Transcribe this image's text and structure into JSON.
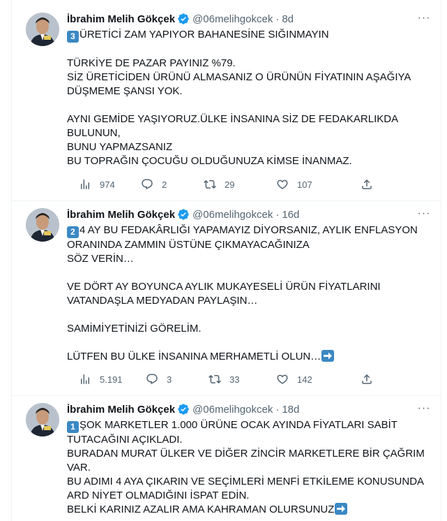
{
  "tweets": [
    {
      "author": "İbrahim Melih Gökçek",
      "handle": "@06melihgokcek",
      "time": "8d",
      "badge": "3",
      "first_line": "ÜRETİCİ ZAM YAPIYOR BAHANESİNE SIĞINMAYIN",
      "paragraphs": [
        "TÜRKİYE DE PAZAR PAYINIZ %79.\nSİZ ÜRETİCİDEN ÜRÜNÜ ALMASANIZ O ÜRÜNÜN FİYATININ AŞAĞIYA DÜŞMEME ŞANSI YOK.",
        "AYNI GEMİDE YAŞIYORUZ.ÜLKE İNSANINA SİZ DE FEDAKARLIKDA BULUNUN,\nBUNU YAPMAZSANIZ\nBU TOPRAĞIN ÇOCUĞU OLDUĞUNUZA KİMSE İNANMAZ."
      ],
      "views": "974",
      "replies": "2",
      "retweets": "29",
      "likes": "107"
    },
    {
      "author": "İbrahim Melih Gökçek",
      "handle": "@06melihgokcek",
      "time": "16d",
      "badge": "2",
      "first_line": "4 AY BU FEDAKÂRLIĞI YAPAMAYIZ DİYORSANIZ, AYLIK ENFLASYON ORANINDA ZAMMIN ÜSTÜNE ÇIKMAYACAĞINIZA\nSÖZ VERİN…",
      "paragraphs": [
        "VE DÖRT AY BOYUNCA AYLIK MUKAYESELİ ÜRÜN FİYATLARINI VATANDAŞLA MEDYADAN PAYLAŞIN…",
        "SAMİMİYETİNİZİ GÖRELİM.",
        "LÜTFEN BU ÜLKE İNSANINA MERHAMETLİ OLUN…"
      ],
      "views": "5.191",
      "replies": "3",
      "retweets": "33",
      "likes": "142"
    },
    {
      "author": "İbrahim Melih Gökçek",
      "handle": "@06melihgokcek",
      "time": "18d",
      "badge": "1",
      "first_line": "ŞOK MARKETLER 1.000 ÜRÜNE OCAK AYINDA FİYATLARI SABİT TUTACAĞINI AÇIKLADI.\nBURADAN MURAT ÜLKER VE DİĞER ZİNCİR MARKETLERE BİR ÇAĞRIM VAR.\nBU ADIMI 4 AYA ÇIKARIN VE SEÇİMLERİ MENFİ ETKİLEME KONUSUNDA ARD NİYET OLMADIĞINI İSPAT EDİN.\nBELKİ KARINIZ AZALIR AMA KAHRAMAN OLURSUNUZ",
      "paragraphs": []
    }
  ],
  "colors": {
    "accent": "#1d9bf0",
    "muted": "#536471",
    "keycap": "#3b88c3"
  },
  "icons": [
    "verified-badge-icon",
    "more-icon",
    "views-icon",
    "reply-icon",
    "retweet-icon",
    "like-icon",
    "share-icon",
    "arrow-right-emoji"
  ]
}
